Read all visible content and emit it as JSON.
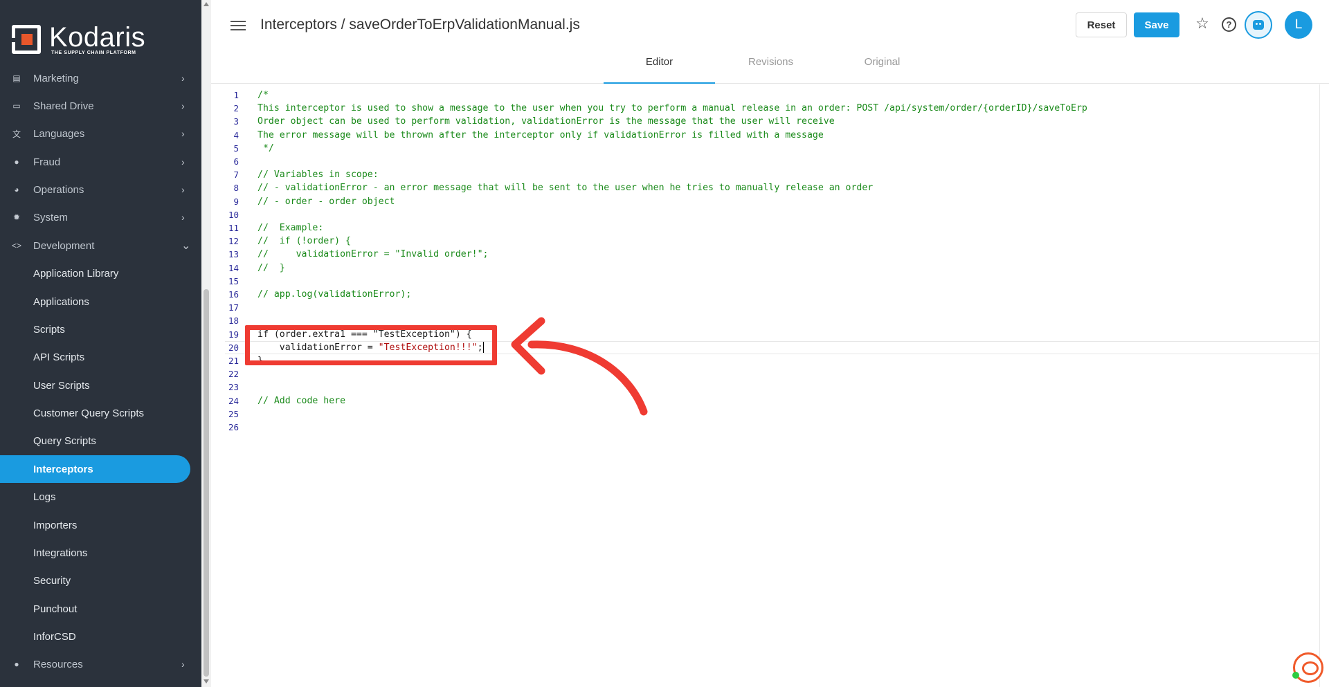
{
  "app": {
    "brand_name": "Kodaris",
    "brand_tagline": "THE SUPPLY CHAIN PLATFORM"
  },
  "sidebar": {
    "items": [
      {
        "label": "Marketing",
        "icon": "id-card-icon",
        "chevron": "›"
      },
      {
        "label": "Shared Drive",
        "icon": "folder-icon",
        "chevron": "›"
      },
      {
        "label": "Languages",
        "icon": "translate-icon",
        "chevron": "›"
      },
      {
        "label": "Fraud",
        "icon": "alert-circle-icon",
        "chevron": "›"
      },
      {
        "label": "Operations",
        "icon": "settings-user-icon",
        "chevron": "›"
      },
      {
        "label": "System",
        "icon": "gear-icon",
        "chevron": "›"
      },
      {
        "label": "Development",
        "icon": "code-icon",
        "chevron": "⌄"
      }
    ],
    "sub_items": [
      "Application Library",
      "Applications",
      "Scripts",
      "API Scripts",
      "User Scripts",
      "Customer Query Scripts",
      "Query Scripts",
      "Interceptors",
      "Logs",
      "Importers",
      "Integrations",
      "Security",
      "Punchout",
      "InforCSD"
    ],
    "active_sub_item": "Interceptors",
    "footer_item": {
      "label": "Resources",
      "icon": "help-circle-icon",
      "chevron": "›"
    }
  },
  "header": {
    "title": "Interceptors / saveOrderToErpValidationManual.js",
    "reset_label": "Reset",
    "save_label": "Save",
    "avatar_initial": "L",
    "accent_color": "#1a9be0"
  },
  "tabs": [
    {
      "label": "Editor",
      "active": true
    },
    {
      "label": "Revisions",
      "active": false
    },
    {
      "label": "Original",
      "active": false
    }
  ],
  "editor": {
    "lines": [
      {
        "num": "1",
        "text": "/*"
      },
      {
        "num": "2",
        "text": "This interceptor is used to show a message to the user when you try to perform a manual release in an order: POST /api/system/order/{orderID}/saveToErp"
      },
      {
        "num": "3",
        "text": "Order object can be used to perform validation, validationError is the message that the user will receive"
      },
      {
        "num": "4",
        "text": "The error message will be thrown after the interceptor only if validationError is filled with a message"
      },
      {
        "num": "5",
        "text": " */"
      },
      {
        "num": "6",
        "text": ""
      },
      {
        "num": "7",
        "text": "// Variables in scope:"
      },
      {
        "num": "8",
        "text": "// - validationError - an error message that will be sent to the user when he tries to manually release an order"
      },
      {
        "num": "9",
        "text": "// - order - order object"
      },
      {
        "num": "10",
        "text": ""
      },
      {
        "num": "11",
        "text": "//  Example:"
      },
      {
        "num": "12",
        "text": "//  if (!order) {"
      },
      {
        "num": "13",
        "text": "//     validationError = \"Invalid order!\";"
      },
      {
        "num": "14",
        "text": "//  }"
      },
      {
        "num": "15",
        "text": ""
      },
      {
        "num": "16",
        "text": "// app.log(validationError);"
      },
      {
        "num": "17",
        "text": ""
      },
      {
        "num": "18",
        "text": ""
      },
      {
        "num": "19",
        "text": "if (order.extra1 === \"TestException\") {"
      },
      {
        "num": "20",
        "text_plain": "    validationError = ",
        "text_string": "\"TestException!!!\"",
        "text_end": ";"
      },
      {
        "num": "21",
        "text": "}"
      },
      {
        "num": "22",
        "text": ""
      },
      {
        "num": "23",
        "text": ""
      },
      {
        "num": "24",
        "text": "// Add code here"
      },
      {
        "num": "25",
        "text": ""
      },
      {
        "num": "26",
        "text": ""
      }
    ],
    "comment_color": "#1a8a1a",
    "string_color": "#b01010",
    "annotation_color": "#ef3b32"
  }
}
